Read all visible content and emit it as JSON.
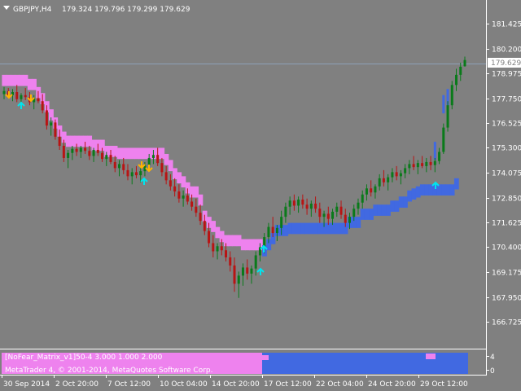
{
  "header": {
    "symbol_label": "GBPJPY,H4",
    "ohlc": "179.324 179.796 179.299 179.629"
  },
  "colors": {
    "background": "#808080",
    "bull_candle": "#0a7a1a",
    "bear_candle": "#b81414",
    "upper_band": "#ee82ee",
    "lower_band": "#4169e1",
    "up_arrow": "#00e5ee",
    "down_arrow": "#ffb300",
    "text": "#ffffff"
  },
  "price_axis": {
    "ticks": [
      "181.425",
      "180.200",
      "178.975",
      "177.750",
      "176.525",
      "175.300",
      "174.075",
      "172.850",
      "171.625",
      "170.400",
      "169.175",
      "167.950",
      "166.725"
    ],
    "current_price": "179.629"
  },
  "time_axis": {
    "labels": [
      "30 Sep 2014",
      "2 Oct 20:00",
      "7 Oct 12:00",
      "10 Oct 04:00",
      "14 Oct 20:00",
      "17 Oct 12:00",
      "22 Oct 04:00",
      "24 Oct 20:00",
      "29 Oct 12:00"
    ]
  },
  "indicator": {
    "name_label": "[NoFear_Matrix_v1]50-4 3.000 1.000 2.000",
    "copyright": "MetaTrader 4, © 2001-2014, MetaQuotes Software Corp.",
    "axis_ticks": [
      "4",
      "0"
    ]
  },
  "chart_data": {
    "type": "candlestick",
    "y_range": [
      166.725,
      181.425
    ],
    "candles": [
      [
        177.95,
        178.3,
        177.7,
        178.1
      ],
      [
        178.1,
        178.25,
        177.8,
        177.9
      ],
      [
        177.9,
        178.2,
        177.6,
        178.05
      ],
      [
        178.05,
        178.4,
        177.55,
        177.7
      ],
      [
        177.7,
        178.0,
        177.3,
        177.9
      ],
      [
        177.9,
        178.25,
        177.65,
        177.8
      ],
      [
        177.8,
        178.05,
        177.4,
        177.55
      ],
      [
        177.55,
        177.9,
        177.2,
        177.75
      ],
      [
        177.75,
        178.1,
        177.5,
        177.6
      ],
      [
        177.6,
        177.95,
        177.0,
        177.15
      ],
      [
        177.15,
        177.4,
        176.2,
        176.4
      ],
      [
        176.4,
        176.8,
        175.9,
        176.55
      ],
      [
        176.55,
        176.7,
        175.7,
        175.85
      ],
      [
        175.85,
        176.2,
        175.2,
        175.4
      ],
      [
        175.4,
        175.7,
        174.6,
        174.8
      ],
      [
        174.8,
        175.2,
        174.3,
        175.05
      ],
      [
        175.05,
        175.4,
        174.7,
        175.25
      ],
      [
        175.25,
        175.5,
        174.9,
        175.1
      ],
      [
        175.1,
        175.4,
        174.8,
        175.3
      ],
      [
        175.3,
        175.6,
        175.0,
        175.15
      ],
      [
        175.15,
        175.4,
        174.7,
        174.9
      ],
      [
        174.9,
        175.3,
        174.6,
        175.2
      ],
      [
        175.2,
        175.5,
        174.9,
        175.05
      ],
      [
        175.05,
        175.3,
        174.6,
        174.75
      ],
      [
        174.75,
        175.1,
        174.4,
        174.95
      ],
      [
        174.95,
        175.2,
        174.5,
        174.6
      ],
      [
        174.6,
        174.9,
        174.1,
        174.3
      ],
      [
        174.3,
        174.7,
        173.9,
        174.5
      ],
      [
        174.5,
        174.8,
        174.0,
        174.2
      ],
      [
        174.2,
        174.5,
        173.7,
        173.9
      ],
      [
        173.9,
        174.3,
        173.5,
        174.1
      ],
      [
        174.1,
        174.4,
        173.8,
        173.95
      ],
      [
        173.95,
        174.3,
        173.6,
        174.15
      ],
      [
        174.15,
        174.6,
        173.9,
        174.45
      ],
      [
        174.45,
        175.0,
        174.2,
        174.8
      ],
      [
        174.8,
        175.2,
        174.5,
        174.95
      ],
      [
        174.95,
        175.3,
        174.4,
        174.55
      ],
      [
        174.55,
        174.8,
        173.9,
        174.1
      ],
      [
        174.1,
        174.4,
        173.5,
        173.7
      ],
      [
        173.7,
        174.0,
        173.2,
        173.4
      ],
      [
        173.4,
        173.8,
        172.9,
        173.15
      ],
      [
        173.15,
        173.5,
        172.6,
        172.8
      ],
      [
        172.8,
        173.2,
        172.4,
        172.95
      ],
      [
        172.95,
        173.3,
        172.5,
        172.65
      ],
      [
        172.65,
        173.0,
        172.2,
        172.4
      ],
      [
        172.4,
        172.8,
        171.9,
        172.1
      ],
      [
        172.1,
        172.5,
        171.5,
        171.7
      ],
      [
        171.7,
        172.0,
        171.0,
        171.2
      ],
      [
        171.2,
        171.6,
        170.4,
        170.6
      ],
      [
        170.6,
        171.0,
        169.9,
        170.2
      ],
      [
        170.2,
        170.6,
        169.8,
        170.45
      ],
      [
        170.45,
        170.8,
        170.0,
        170.25
      ],
      [
        170.25,
        170.6,
        169.7,
        169.9
      ],
      [
        169.9,
        170.2,
        169.2,
        169.5
      ],
      [
        169.5,
        169.9,
        168.2,
        168.6
      ],
      [
        168.6,
        169.2,
        167.9,
        169.0
      ],
      [
        169.0,
        169.6,
        168.5,
        169.4
      ],
      [
        169.4,
        169.8,
        168.8,
        169.1
      ],
      [
        169.1,
        169.5,
        168.6,
        169.35
      ],
      [
        169.35,
        170.2,
        169.0,
        170.0
      ],
      [
        170.0,
        170.6,
        169.7,
        170.4
      ],
      [
        170.4,
        171.1,
        170.1,
        170.9
      ],
      [
        170.9,
        171.6,
        170.6,
        171.4
      ],
      [
        171.4,
        171.9,
        170.9,
        171.1
      ],
      [
        171.1,
        171.5,
        170.7,
        171.35
      ],
      [
        171.35,
        172.2,
        171.0,
        171.9
      ],
      [
        171.9,
        172.6,
        171.6,
        172.4
      ],
      [
        172.4,
        172.9,
        172.0,
        172.7
      ],
      [
        172.7,
        173.0,
        172.2,
        172.45
      ],
      [
        172.45,
        172.9,
        172.1,
        172.75
      ],
      [
        172.75,
        173.0,
        172.3,
        172.5
      ],
      [
        172.5,
        172.8,
        172.0,
        172.3
      ],
      [
        172.3,
        172.7,
        171.9,
        172.55
      ],
      [
        172.55,
        172.9,
        172.1,
        172.3
      ],
      [
        172.3,
        172.6,
        171.6,
        171.9
      ],
      [
        171.9,
        172.2,
        171.4,
        172.05
      ],
      [
        172.05,
        172.4,
        171.5,
        171.8
      ],
      [
        171.8,
        172.3,
        171.5,
        172.15
      ],
      [
        172.15,
        172.6,
        171.9,
        172.4
      ],
      [
        172.4,
        172.7,
        171.8,
        172.0
      ],
      [
        172.0,
        172.3,
        171.4,
        171.6
      ],
      [
        171.6,
        172.1,
        171.3,
        171.9
      ],
      [
        171.9,
        172.5,
        171.7,
        172.3
      ],
      [
        172.3,
        172.8,
        172.0,
        172.6
      ],
      [
        172.6,
        173.2,
        172.3,
        173.0
      ],
      [
        173.0,
        173.5,
        172.7,
        173.3
      ],
      [
        173.3,
        173.7,
        172.9,
        173.1
      ],
      [
        173.1,
        173.5,
        172.8,
        173.4
      ],
      [
        173.4,
        174.0,
        173.2,
        173.8
      ],
      [
        173.8,
        174.2,
        173.4,
        173.6
      ],
      [
        173.6,
        174.0,
        173.2,
        173.85
      ],
      [
        173.85,
        174.3,
        173.6,
        174.1
      ],
      [
        174.1,
        174.4,
        173.7,
        173.9
      ],
      [
        173.9,
        174.2,
        173.5,
        174.05
      ],
      [
        174.05,
        174.5,
        173.8,
        174.3
      ],
      [
        174.3,
        174.7,
        174.0,
        174.5
      ],
      [
        174.5,
        174.9,
        174.2,
        174.35
      ],
      [
        174.35,
        174.7,
        174.0,
        174.55
      ],
      [
        174.55,
        174.9,
        174.3,
        174.4
      ],
      [
        174.4,
        174.8,
        174.1,
        174.6
      ],
      [
        174.6,
        174.9,
        174.2,
        174.45
      ],
      [
        174.45,
        174.8,
        174.1,
        174.65
      ],
      [
        174.65,
        175.3,
        174.5,
        175.1
      ],
      [
        175.1,
        176.5,
        175.0,
        176.3
      ],
      [
        176.3,
        177.6,
        176.1,
        177.4
      ],
      [
        177.4,
        178.6,
        177.2,
        178.4
      ],
      [
        178.4,
        179.2,
        178.1,
        178.9
      ],
      [
        178.9,
        179.5,
        178.6,
        179.3
      ],
      [
        179.324,
        179.796,
        179.299,
        179.629
      ]
    ]
  }
}
